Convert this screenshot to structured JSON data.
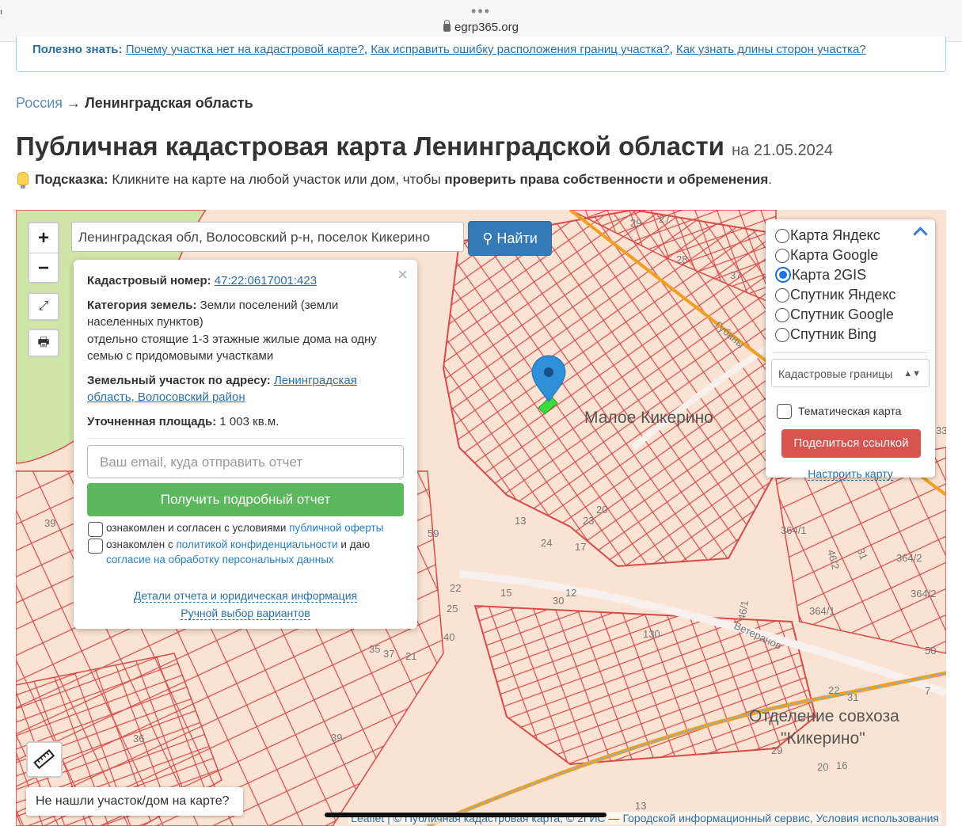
{
  "browser": {
    "url": "egrp365.org"
  },
  "useful": {
    "label": "Полезно знать:",
    "links": [
      "Почему участка нет на кадастровой карте?",
      "Как исправить ошибку расположения границ участка?",
      "Как узнать длины сторон участка?"
    ]
  },
  "breadcrumb": {
    "root": "Россия",
    "arrow": "→",
    "current": "Ленинградская область"
  },
  "title": {
    "main": "Публичная кадастровая карта Ленинградской области",
    "date": "на 21.05.2024"
  },
  "hint": {
    "label": "Подсказка:",
    "text": "Кликните на карте на любой участок или дом, чтобы",
    "bold": "проверить права собственности и обременения",
    "end": "."
  },
  "map": {
    "zoom_in": "+",
    "zoom_out": "−",
    "search_value": "Ленинградская обл, Волосовский р-н, поселок Кикерино",
    "find_button": "Найти",
    "place_labels": [
      "Малое Кикерино",
      "Отделение совхоза",
      "\"Кикерино\""
    ],
    "street_labels": [
      "Губаны",
      "Ветеранов"
    ],
    "parcel_numbers": [
      "39",
      "39",
      "364/1",
      "364/2",
      "364/2",
      "364/1",
      "31",
      "46/2",
      "46/1",
      "23",
      "20",
      "17",
      "13",
      "59",
      "24",
      "15",
      "12",
      "30",
      "22",
      "25",
      "40",
      "35",
      "37",
      "21",
      "36",
      "130",
      "50",
      "7",
      "22",
      "31",
      "20",
      "16",
      "29",
      "13",
      "28",
      "37",
      "33",
      "29",
      "27"
    ],
    "not_found": "Не нашли участок/дом на карте?",
    "attribution": "Leaflet | © Публичная кадастровая карта, © 2ГИС — Городской информационный сервис, Условия использования"
  },
  "popup": {
    "close": "×",
    "cadastral_label": "Кадастровый номер:",
    "cadastral_value": "47:22:0617001:423",
    "category_label": "Категория земель:",
    "category_value": "Земли поселений (земли",
    "category_value2": "населенных пунктов)",
    "usage_line1": "отдельно стоящие 1-3 этажные жилые дома на одну",
    "usage_line2": "семью с придомовыми участками",
    "address_label": "Земельный участок по адресу:",
    "address_value1": "Ленинградская",
    "address_value2": "область, Волосовский район",
    "area_label": "Уточненная площадь:",
    "area_value": "1 003 кв.м.",
    "email_placeholder": "Ваш email, куда отправить отчет",
    "report_button": "Получить подробный отчет",
    "agree1_text": "ознакомлен и согласен с условиями",
    "agree1_link": "публичной оферты",
    "agree2_text": "ознакомлен с",
    "agree2_link": "политикой конфиденциальности",
    "agree2_text2": "и даю",
    "agree2_link2": "согласие на обработку персональных данных",
    "details_link": "Детали отчета и юридическая информация",
    "manual_link": "Ручной выбор вариантов"
  },
  "layers": {
    "options": [
      "Карта Яндекс",
      "Карта Google",
      "Карта 2GIS",
      "Спутник Яндекс",
      "Спутник Google",
      "Спутник Bing"
    ],
    "selected": "Карта 2GIS",
    "overlay_select": "Кадастровые границы",
    "thematic": "Тематическая карта",
    "share_button": "Поделиться ссылкой",
    "setup_link": "Настроить карту"
  },
  "colors": {
    "find": "#337ab7",
    "report": "#5cb85c",
    "share": "#d9534f",
    "parcel": "#d84a4a",
    "road": "#f0a020"
  }
}
